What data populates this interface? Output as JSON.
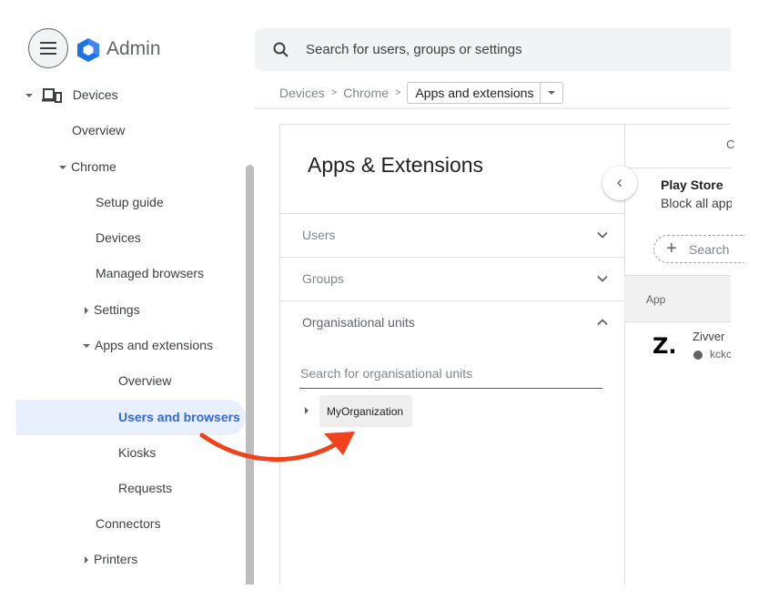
{
  "header": {
    "menu_icon": "hamburger-menu-icon",
    "logo_icon": "google-admin-hexagon-icon",
    "brand": "Admin",
    "search_icon": "search-icon",
    "search_placeholder": "Search for users, groups or settings"
  },
  "breadcrumb": {
    "items": [
      "Devices",
      "Chrome"
    ],
    "separator": ">",
    "current": "Apps and extensions",
    "dropdown_icon": "caret-down-icon"
  },
  "sidebar": {
    "items": [
      {
        "label": "Devices",
        "level": 0,
        "expander": "expanded",
        "icon": "devices-icon"
      },
      {
        "label": "Overview",
        "level": 1
      },
      {
        "label": "Chrome",
        "level": 1,
        "expander": "expanded"
      },
      {
        "label": "Setup guide",
        "level": 2
      },
      {
        "label": "Devices",
        "level": 2
      },
      {
        "label": "Managed browsers",
        "level": 2
      },
      {
        "label": "Settings",
        "level": 2,
        "expander": "collapsed"
      },
      {
        "label": "Apps and extensions",
        "level": 2,
        "expander": "expanded"
      },
      {
        "label": "Overview",
        "level": 3
      },
      {
        "label": "Users and browsers",
        "level": 3,
        "active": true
      },
      {
        "label": "Kiosks",
        "level": 3
      },
      {
        "label": "Requests",
        "level": 3
      },
      {
        "label": "Connectors",
        "level": 2
      },
      {
        "label": "Printers",
        "level": 2,
        "expander": "collapsed"
      }
    ],
    "active_color": "#3367d6",
    "active_bg": "#e8f0fe"
  },
  "main": {
    "title": "Apps & Extensions",
    "accordion": [
      {
        "label": "Users",
        "state": "collapsed"
      },
      {
        "label": "Groups",
        "state": "collapsed"
      },
      {
        "label": "Organisational units",
        "state": "expanded"
      }
    ],
    "ou_search_placeholder": "Search for organisational units",
    "ou_tree": [
      {
        "label": "MyOrganization",
        "expander": "collapsed"
      }
    ]
  },
  "right_panel": {
    "top_clipped_text": "C",
    "collapse_icon": "chevron-left-icon",
    "play_store_title": "Play Store",
    "play_store_subtitle": "Block all app",
    "add_search_label": "Search",
    "add_icon": "plus-icon",
    "table_header": "App",
    "apps": [
      {
        "logo_text": "Z.",
        "name": "Zivver",
        "source_icon": "google-icon",
        "source": "kckc"
      }
    ]
  },
  "annotation": {
    "type": "curved-arrow",
    "color": "#f0421b",
    "from": "Users and browsers",
    "to": "MyOrganization"
  }
}
